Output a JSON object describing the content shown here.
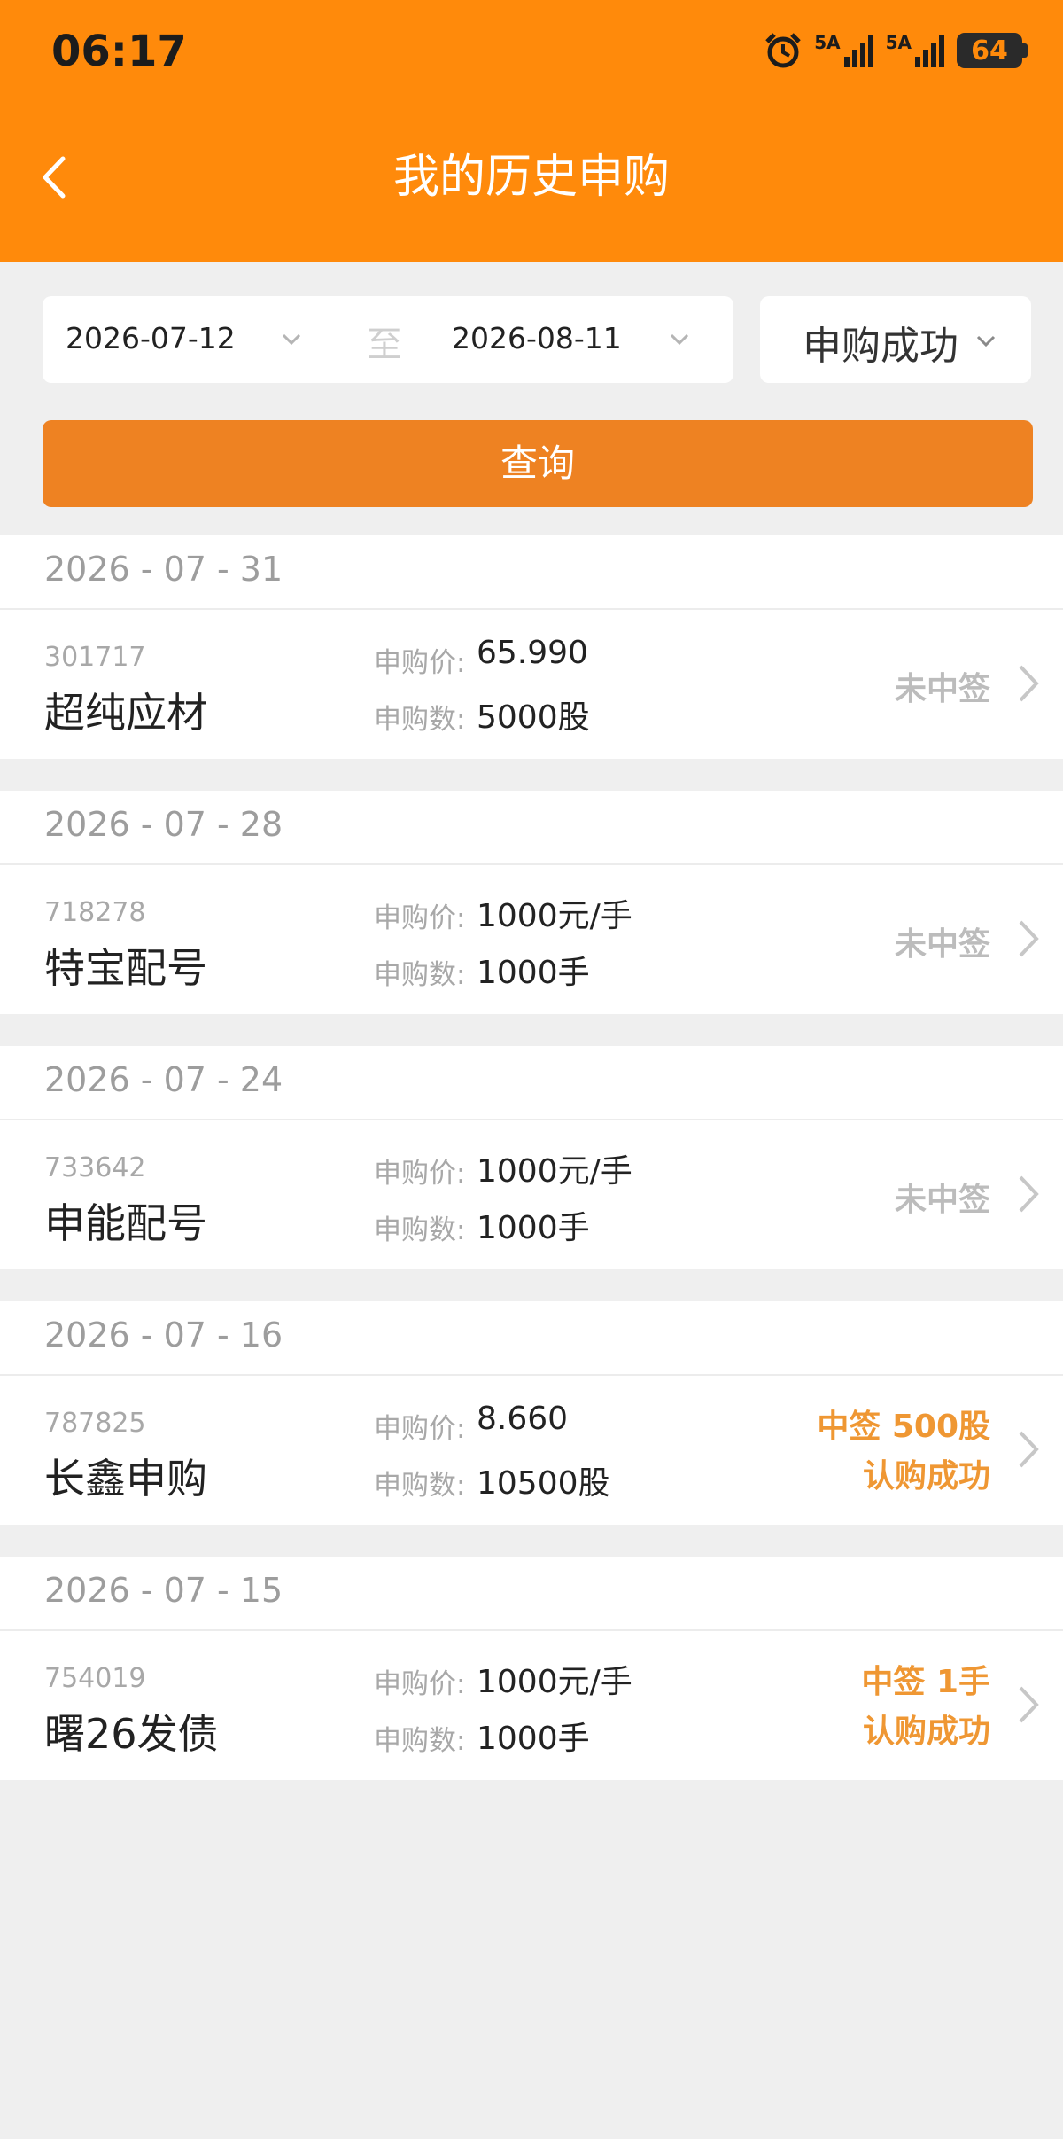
{
  "status_bar": {
    "time": "06:17",
    "net1": "5A",
    "net2": "5A",
    "battery": "64"
  },
  "header": {
    "title": "我的历史申购"
  },
  "filter": {
    "start_date": "2026-07-12",
    "separator": "至",
    "end_date": "2026-08-11",
    "status": "申购成功",
    "query_label": "查询"
  },
  "labels": {
    "price": "申购价:",
    "quantity": "申购数:"
  },
  "groups": [
    {
      "date": "2026 - 07 - 31",
      "code": "301717",
      "name": "超纯应材",
      "price": "65.990",
      "quantity": "5000股",
      "result_line1": "未中签",
      "result_line2": ""
    },
    {
      "date": "2026 - 07 - 28",
      "code": "718278",
      "name": "特宝配号",
      "price": "1000元/手",
      "quantity": "1000手",
      "result_line1": "未中签",
      "result_line2": ""
    },
    {
      "date": "2026 - 07 - 24",
      "code": "733642",
      "name": "申能配号",
      "price": "1000元/手",
      "quantity": "1000手",
      "result_line1": "未中签",
      "result_line2": ""
    },
    {
      "date": "2026 - 07 - 16",
      "code": "787825",
      "name": "长鑫申购",
      "price": "8.660",
      "quantity": "10500股",
      "result_line1": "中签 500股",
      "result_line2": "认购成功"
    },
    {
      "date": "2026 - 07 - 15",
      "code": "754019",
      "name": "曙26发债",
      "price": "1000元/手",
      "quantity": "1000手",
      "result_line1": "中签 1手",
      "result_line2": "认购成功"
    }
  ],
  "colors": {
    "header": "#ff8a0b",
    "query_button": "#ee8222",
    "won": "#ef9733",
    "lost": "#bcbcbc"
  }
}
